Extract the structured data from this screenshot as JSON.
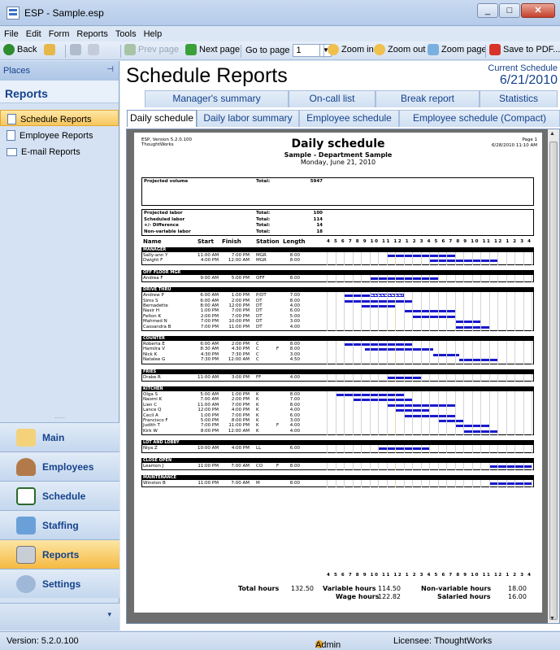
{
  "window": {
    "title": "ESP - Sample.esp"
  },
  "menu": [
    "File",
    "Edit",
    "Form",
    "Reports",
    "Tools",
    "Help"
  ],
  "toolbar": {
    "back": "Back",
    "prev_page": "Prev page",
    "next_page": "Next page",
    "goto_label": "Go to page",
    "goto_value": "1",
    "zoom_in": "Zoom in",
    "zoom_out": "Zoom out",
    "zoom_page": "Zoom page",
    "save_pdf": "Save to PDF..."
  },
  "sidebar": {
    "places": "Places",
    "section": "Reports",
    "items": [
      "Schedule Reports",
      "Employee Reports",
      "E-mail Reports"
    ],
    "buttons": [
      "Main",
      "Employees",
      "Schedule",
      "Staffing",
      "Reports",
      "Settings"
    ]
  },
  "page": {
    "title": "Schedule Reports",
    "current_schedule_label": "Current Schedule",
    "current_schedule_date": "6/21/2010"
  },
  "tabs_top": [
    "Manager's summary",
    "On-call list",
    "Break report",
    "Statistics"
  ],
  "tabs_bottom": [
    "Daily schedule",
    "Daily labor summary",
    "Employee schedule",
    "Employee schedule (Compact)"
  ],
  "report": {
    "version": "ESP, Version 5.2.0.100",
    "company": "ThoughtWorks",
    "title": "Daily schedule",
    "subtitle": "Sample - Department Sample",
    "date": "Monday, June 21, 2010",
    "page": "Page 1",
    "printed": "6/28/2010 11:10 AM",
    "projected_volume_label": "Projected volume",
    "projected_volume_total_label": "Total:",
    "projected_volume_total": "5947",
    "labor_rows": [
      {
        "label": "Projected labor",
        "total": "100"
      },
      {
        "label": "Scheduled labor",
        "total": "114"
      },
      {
        "label": "+/- Difference",
        "total": "14"
      },
      {
        "label": "Non-variable labor",
        "total": "18"
      }
    ],
    "col_headers": [
      "Name",
      "Start",
      "Finish",
      "Station",
      "Length"
    ],
    "hours_axis": "4 5 6 7 8 9 10 11 12 1 2 3 4 5 6 7 8 9 10 11 12 1 2 3 4",
    "groups": [
      {
        "name": "MANAGER",
        "rows": [
          {
            "name": "Sally-ann Y",
            "start": "11:00 AM",
            "finish": "7:00 PM",
            "station": "MGR",
            "length": "8.00",
            "s": 11,
            "e": 19
          },
          {
            "name": "Dwight F",
            "start": "4:00 PM",
            "finish": "12:00 AM",
            "station": "MGR",
            "length": "8.00",
            "s": 16,
            "e": 24
          }
        ]
      },
      {
        "name": "OFF FLOOR MGR",
        "rows": [
          {
            "name": "Andrea F",
            "start": "9:00 AM",
            "finish": "5:00 PM",
            "station": "OFF",
            "length": "8.00",
            "s": 9,
            "e": 17
          }
        ]
      },
      {
        "name": "DRIVE THRU",
        "rows": [
          {
            "name": "Andrew P",
            "start": "6:00 AM",
            "finish": "1:00 PM",
            "station": "P/DT",
            "length": "7.00",
            "s": 6,
            "e": 13,
            "hatch": 9
          },
          {
            "name": "Sims S",
            "start": "6:00 AM",
            "finish": "2:00 PM",
            "station": "DT",
            "length": "8.00",
            "s": 6,
            "e": 14
          },
          {
            "name": "Bernadette",
            "start": "8:00 AM",
            "finish": "12:00 PM",
            "station": "DT",
            "length": "4.00",
            "s": 8,
            "e": 12
          },
          {
            "name": "Nasir H",
            "start": "1:00 PM",
            "finish": "7:00 PM",
            "station": "DT",
            "length": "6.00",
            "s": 13,
            "e": 19
          },
          {
            "name": "Felton K",
            "start": "2:00 PM",
            "finish": "7:00 PM",
            "station": "DT",
            "length": "5.00",
            "s": 14,
            "e": 19
          },
          {
            "name": "Mahmed N",
            "start": "7:00 PM",
            "finish": "10:00 PM",
            "station": "DT",
            "length": "3.00",
            "s": 19,
            "e": 22
          },
          {
            "name": "Cassandra B",
            "start": "7:00 PM",
            "finish": "11:00 PM",
            "station": "DT",
            "length": "4.00",
            "s": 19,
            "e": 23
          }
        ]
      },
      {
        "name": "COUNTER",
        "rows": [
          {
            "name": "Roberta E",
            "start": "6:00 AM",
            "finish": "2:00 PM",
            "station": "C",
            "flag": "",
            "length": "8.00",
            "s": 6,
            "e": 14
          },
          {
            "name": "Hamilra V",
            "start": "8:30 AM",
            "finish": "4:30 PM",
            "station": "C",
            "flag": "F",
            "length": "8.00",
            "s": 8.5,
            "e": 16.5
          },
          {
            "name": "Nick K",
            "start": "4:30 PM",
            "finish": "7:30 PM",
            "station": "C",
            "flag": "",
            "length": "3.00",
            "s": 16.5,
            "e": 19.5
          },
          {
            "name": "Natalee G",
            "start": "7:30 PM",
            "finish": "12:00 AM",
            "station": "C",
            "flag": "",
            "length": "4.50",
            "s": 19.5,
            "e": 24
          }
        ]
      },
      {
        "name": "FRIES",
        "rows": [
          {
            "name": "Drake R",
            "start": "11:00 AM",
            "finish": "3:00 PM",
            "station": "FF",
            "length": "4.00",
            "s": 11,
            "e": 15
          }
        ]
      },
      {
        "name": "KITCHEN",
        "rows": [
          {
            "name": "Olga S",
            "start": "5:00 AM",
            "finish": "1:00 PM",
            "station": "K",
            "flag": "",
            "length": "8.00",
            "s": 5,
            "e": 13
          },
          {
            "name": "Naomi K",
            "start": "7:00 AM",
            "finish": "2:00 PM",
            "station": "K",
            "flag": "",
            "length": "7.00",
            "s": 7,
            "e": 14
          },
          {
            "name": "Lien C",
            "start": "11:00 AM",
            "finish": "7:00 PM",
            "station": "K",
            "flag": "",
            "length": "8.00",
            "s": 11,
            "e": 19
          },
          {
            "name": "Lance Q",
            "start": "12:00 PM",
            "finish": "4:00 PM",
            "station": "K",
            "flag": "",
            "length": "4.00",
            "s": 12,
            "e": 16
          },
          {
            "name": "Cecil A",
            "start": "1:00 PM",
            "finish": "7:00 PM",
            "station": "K",
            "flag": "",
            "length": "6.00",
            "s": 13,
            "e": 19
          },
          {
            "name": "Francisco F",
            "start": "5:00 PM",
            "finish": "8:00 PM",
            "station": "K",
            "flag": "",
            "length": "3.00",
            "s": 17,
            "e": 20
          },
          {
            "name": "Judith T",
            "start": "7:00 PM",
            "finish": "11:00 PM",
            "station": "K",
            "flag": "F",
            "length": "4.00",
            "s": 19,
            "e": 23
          },
          {
            "name": "Kirk W",
            "start": "8:00 PM",
            "finish": "12:00 AM",
            "station": "K",
            "flag": "",
            "length": "4.00",
            "s": 20,
            "e": 24
          }
        ]
      },
      {
        "name": "LOT AND LOBBY",
        "rows": [
          {
            "name": "Niya Z",
            "start": "10:00 AM",
            "finish": "4:00 PM",
            "station": "LL",
            "length": "6.00",
            "s": 10,
            "e": 16
          }
        ]
      },
      {
        "name": "CLOSE OPEN",
        "rows": [
          {
            "name": "Leamon J",
            "start": "11:00 PM",
            "finish": "7:00 AM",
            "station": "CO",
            "flag": "F",
            "length": "8.00",
            "s": 23,
            "e": 28
          }
        ]
      },
      {
        "name": "MAINTENANCE",
        "rows": [
          {
            "name": "Winston B",
            "start": "11:00 PM",
            "finish": "7:00 AM",
            "station": "M",
            "length": "8.00",
            "s": 23,
            "e": 28
          }
        ]
      }
    ],
    "totals": {
      "total_hours_label": "Total hours",
      "total_hours": "132.50",
      "variable_label": "Variable hours",
      "variable": "114.50",
      "wage_label": "Wage hours",
      "wage": "122.82",
      "nonvariable_label": "Non-variable hours",
      "nonvariable": "18.00",
      "salaried_label": "Salaried hours",
      "salaried": "16.00"
    }
  },
  "status": {
    "version": "Version: 5.2.0.100",
    "user": "Admin",
    "licensee": "Licensee: ThoughtWorks"
  }
}
